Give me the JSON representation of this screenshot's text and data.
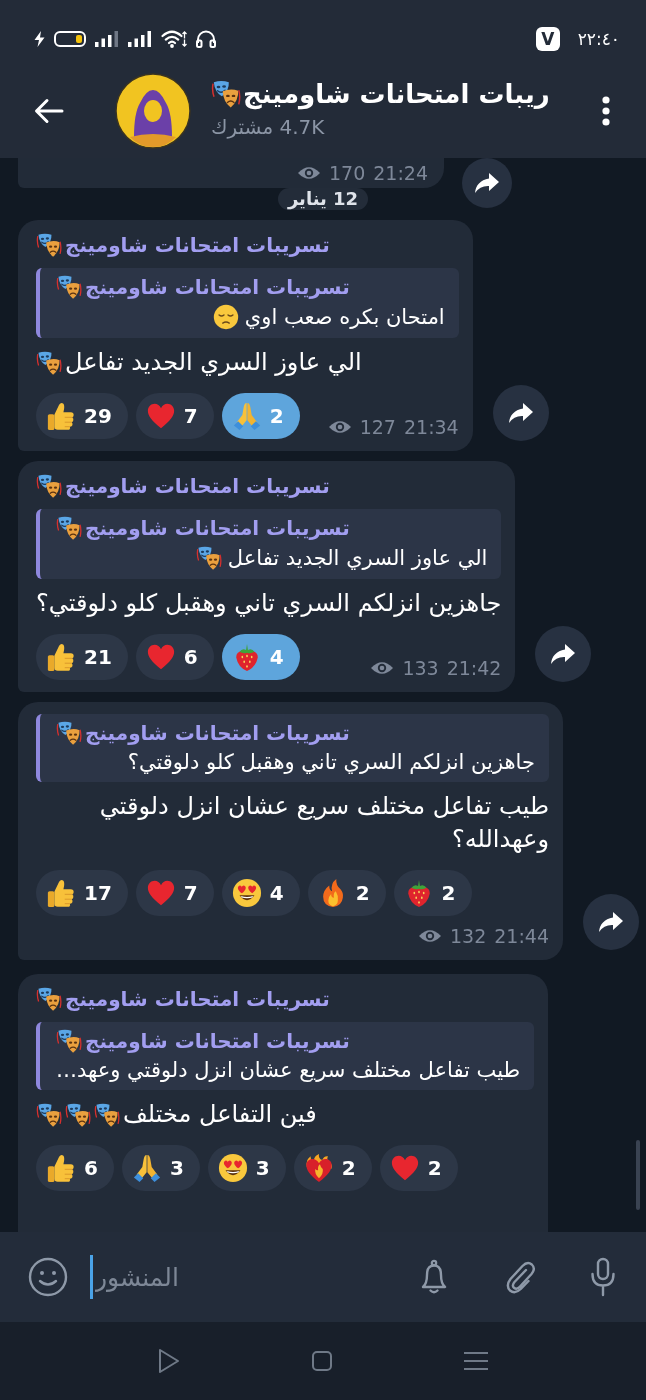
{
  "status_bar": {
    "app_badge": "V",
    "time": "٢٢:٤٠"
  },
  "header": {
    "title": "ريبات امتحانات شاومينج",
    "title_emoji": [
      {
        "kind": "masks"
      }
    ],
    "subtitle": "4.7K مشترك"
  },
  "partial_message": {
    "views": "170",
    "time": "21:24"
  },
  "date_chip": "12 يناير",
  "messages": [
    {
      "cut_off": false,
      "author": {
        "name": "تسريبات امتحانات شاومينج",
        "emoji": [
          {
            "kind": "masks"
          }
        ]
      },
      "reply": {
        "author": {
          "name": "تسريبات امتحانات شاومينج",
          "emoji": [
            {
              "kind": "masks"
            }
          ]
        },
        "text": "امتحان بكره صعب اوي",
        "text_emoji": [
          {
            "kind": "pensive-face"
          }
        ]
      },
      "text": "الي عاوز السري الجديد تفاعل",
      "text_emoji": [
        {
          "kind": "masks"
        }
      ],
      "reactions": [
        {
          "kind": "praying-hands",
          "count": "2",
          "selected": true
        },
        {
          "kind": "heart",
          "count": "7",
          "selected": false
        },
        {
          "kind": "thumbs-up",
          "count": "29",
          "selected": false
        }
      ],
      "views": "127",
      "time": "21:34"
    },
    {
      "cut_off": false,
      "author": {
        "name": "تسريبات امتحانات شاومينج",
        "emoji": [
          {
            "kind": "masks"
          }
        ]
      },
      "reply": {
        "author": {
          "name": "تسريبات امتحانات شاومينج",
          "emoji": [
            {
              "kind": "masks"
            }
          ]
        },
        "text": "الي عاوز السري الجديد تفاعل",
        "text_emoji": [
          {
            "kind": "masks"
          }
        ]
      },
      "text": "جاهزين انزلكم السري تاني وهقبل كلو دلوقتي؟",
      "reactions": [
        {
          "kind": "strawberry",
          "count": "4",
          "selected": true
        },
        {
          "kind": "heart",
          "count": "6",
          "selected": false
        },
        {
          "kind": "thumbs-up",
          "count": "21",
          "selected": false
        }
      ],
      "views": "133",
      "time": "21:42"
    },
    {
      "cut_off": false,
      "reply": {
        "author": {
          "name": "تسريبات امتحانات شاومينج",
          "emoji": [
            {
              "kind": "masks"
            }
          ]
        },
        "text": "جاهزين انزلكم السري تاني وهقبل كلو دلوقتي؟"
      },
      "text": "طيب تفاعل مختلف سريع عشان انزل دلوقتي وعهدالله؟",
      "reactions": [
        {
          "kind": "strawberry",
          "count": "2",
          "selected": false
        },
        {
          "kind": "fire",
          "count": "2",
          "selected": false
        },
        {
          "kind": "heart-eyes",
          "count": "4",
          "selected": false
        },
        {
          "kind": "heart",
          "count": "7",
          "selected": false
        },
        {
          "kind": "thumbs-up",
          "count": "17",
          "selected": false
        }
      ],
      "views": "132",
      "time": "21:44"
    },
    {
      "cut_off": true,
      "author": {
        "name": "تسريبات امتحانات شاومينج",
        "emoji": [
          {
            "kind": "masks"
          }
        ]
      },
      "reply": {
        "author": {
          "name": "تسريبات امتحانات شاومينج",
          "emoji": [
            {
              "kind": "masks"
            }
          ]
        },
        "text": "طيب تفاعل مختلف سريع عشان انزل دلوقتي وعهد…"
      },
      "text": "فين التفاعل مختلف",
      "text_emoji": [
        {
          "kind": "masks"
        },
        {
          "kind": "masks"
        },
        {
          "kind": "masks"
        }
      ],
      "reactions": [
        {
          "kind": "heart",
          "count": "2",
          "selected": false
        },
        {
          "kind": "heart-on-fire",
          "count": "2",
          "selected": false
        },
        {
          "kind": "heart-eyes",
          "count": "3",
          "selected": false
        },
        {
          "kind": "praying-hands",
          "count": "3",
          "selected": false
        },
        {
          "kind": "thumbs-up",
          "count": "6",
          "selected": false
        }
      ]
    }
  ],
  "composer": {
    "placeholder": "المنشور"
  }
}
